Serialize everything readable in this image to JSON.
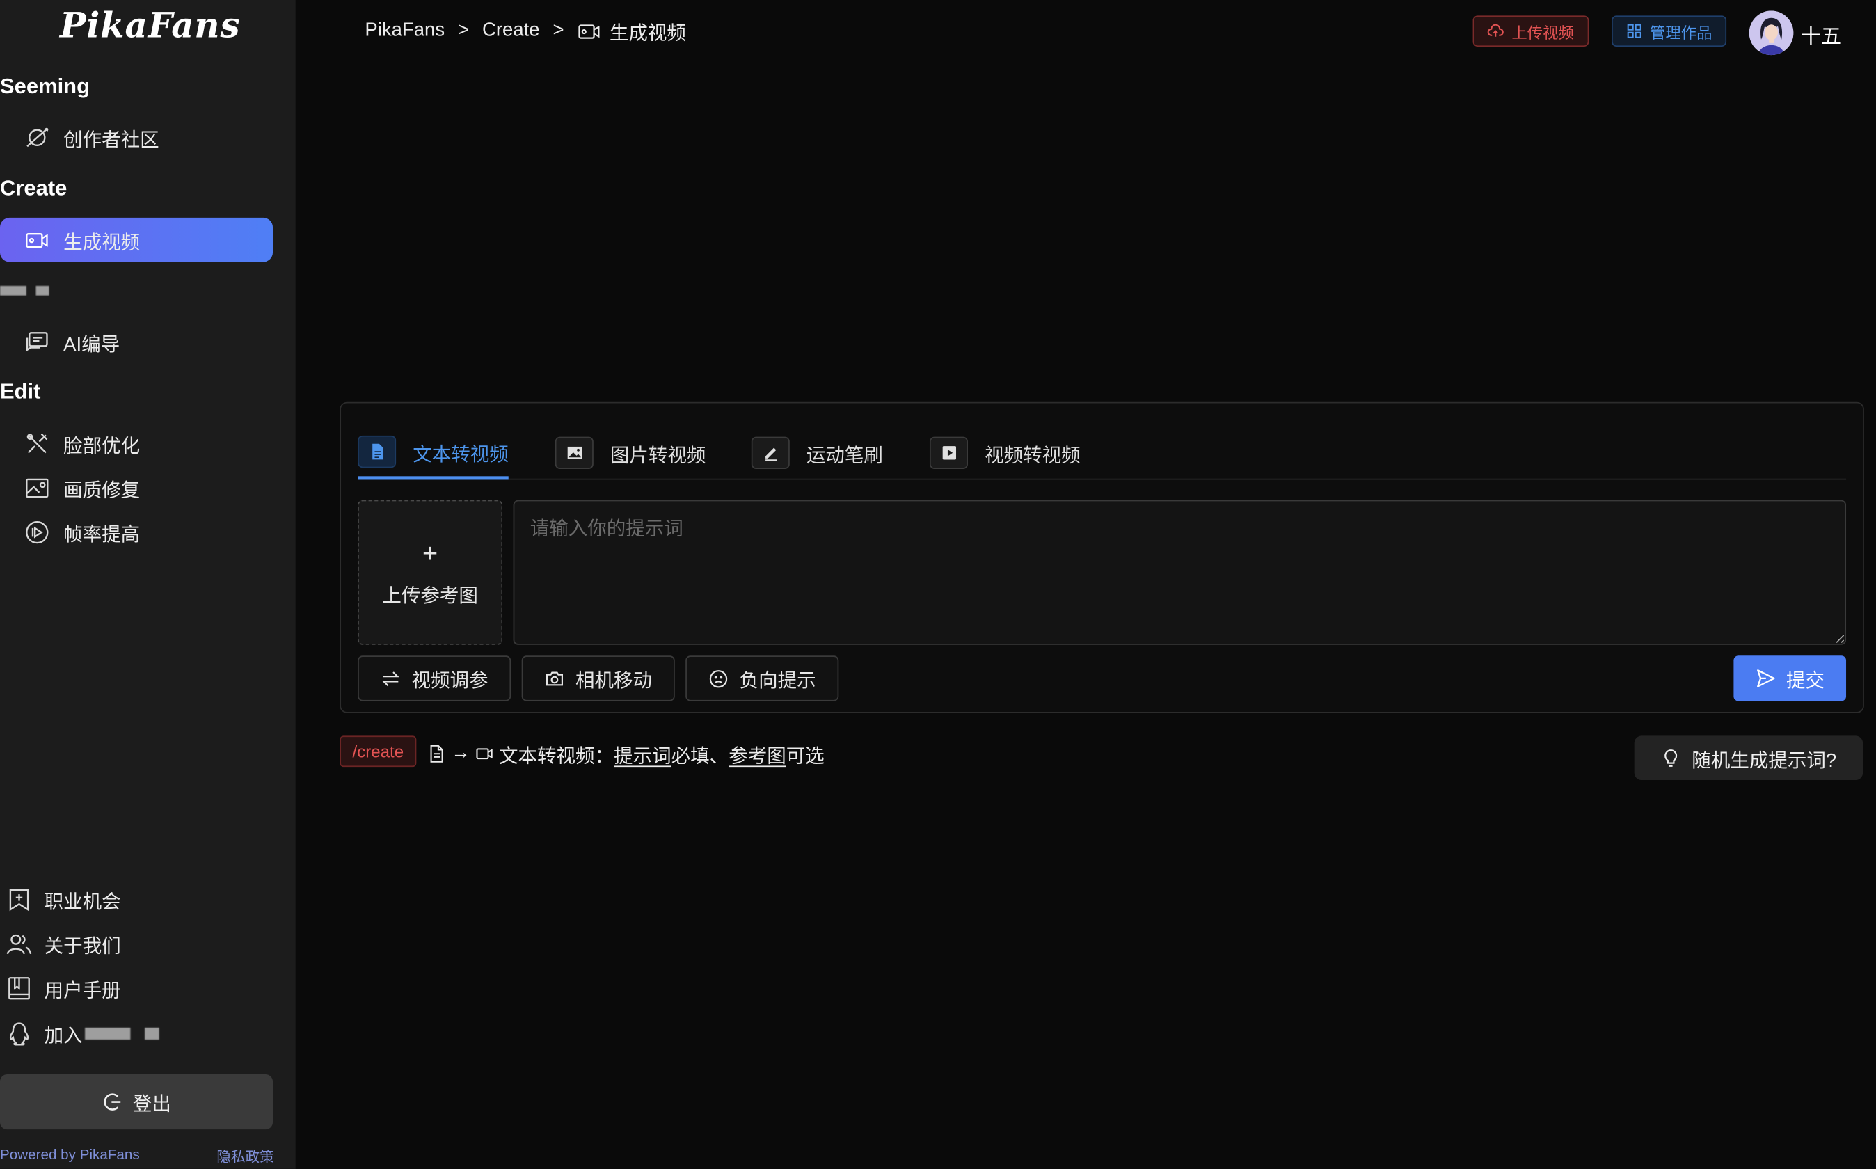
{
  "brand": "PikaFans",
  "sidebar": {
    "sections": [
      {
        "title": "Seeming",
        "items": [
          {
            "label": "创作者社区",
            "icon": "planet-icon"
          }
        ]
      },
      {
        "title": "Create",
        "items": [
          {
            "label": "生成视频",
            "icon": "video-camera-icon",
            "active": true
          }
        ]
      },
      {
        "title": "",
        "items": [
          {
            "label": "AI编导",
            "icon": "chat-icon"
          }
        ]
      },
      {
        "title": "Edit",
        "items": [
          {
            "label": "脸部优化",
            "icon": "tools-icon"
          },
          {
            "label": "画质修复",
            "icon": "image-edit-icon"
          },
          {
            "label": "帧率提高",
            "icon": "play-circle-icon"
          }
        ]
      }
    ],
    "footer_items": [
      {
        "label": "职业机会",
        "icon": "bookmark-plus-icon"
      },
      {
        "label": "关于我们",
        "icon": "users-icon"
      },
      {
        "label": "用户手册",
        "icon": "book-icon"
      },
      {
        "label": "加入",
        "icon": "qq-icon"
      }
    ],
    "logout_label": "登出",
    "powered_by": "Powered by PikaFans",
    "privacy_label": "隐私政策"
  },
  "header": {
    "breadcrumb": [
      "PikaFans",
      "Create",
      "生成视频"
    ],
    "breadcrumb_sep": ">",
    "upload_video_label": "上传视频",
    "manage_works_label": "管理作品",
    "username": "十五"
  },
  "panel": {
    "tabs": [
      {
        "label": "文本转视频",
        "icon": "document-icon",
        "active": true
      },
      {
        "label": "图片转视频",
        "icon": "image-icon"
      },
      {
        "label": "运动笔刷",
        "icon": "pencil-icon"
      },
      {
        "label": "视频转视频",
        "icon": "play-square-icon"
      }
    ],
    "upload_ref_label": "上传参考图",
    "upload_ref_plus": "+",
    "prompt_placeholder": "请输入你的提示词",
    "prompt_value": "",
    "options": [
      {
        "label": "视频调参",
        "icon": "swap-icon"
      },
      {
        "label": "相机移动",
        "icon": "camera-icon"
      },
      {
        "label": "负向提示",
        "icon": "frown-icon"
      }
    ],
    "submit_label": "提交"
  },
  "hint": {
    "route": "/create",
    "arrow": "→",
    "text_prefix": "文本转视频：",
    "required_label": "提示词",
    "required_suffix": "必填、",
    "optional_label": "参考图",
    "optional_suffix": "可选"
  },
  "random_prompt_label": "随机生成提示词?",
  "colors": {
    "accent_blue": "#4d95ec",
    "active_gradient_start": "#6b63f0",
    "active_gradient_end": "#4f7ff5",
    "danger_red": "#e25353",
    "submit_blue": "#4b7cf2",
    "sidebar_bg": "#1c1c1c",
    "main_bg": "#0a0a0a"
  }
}
